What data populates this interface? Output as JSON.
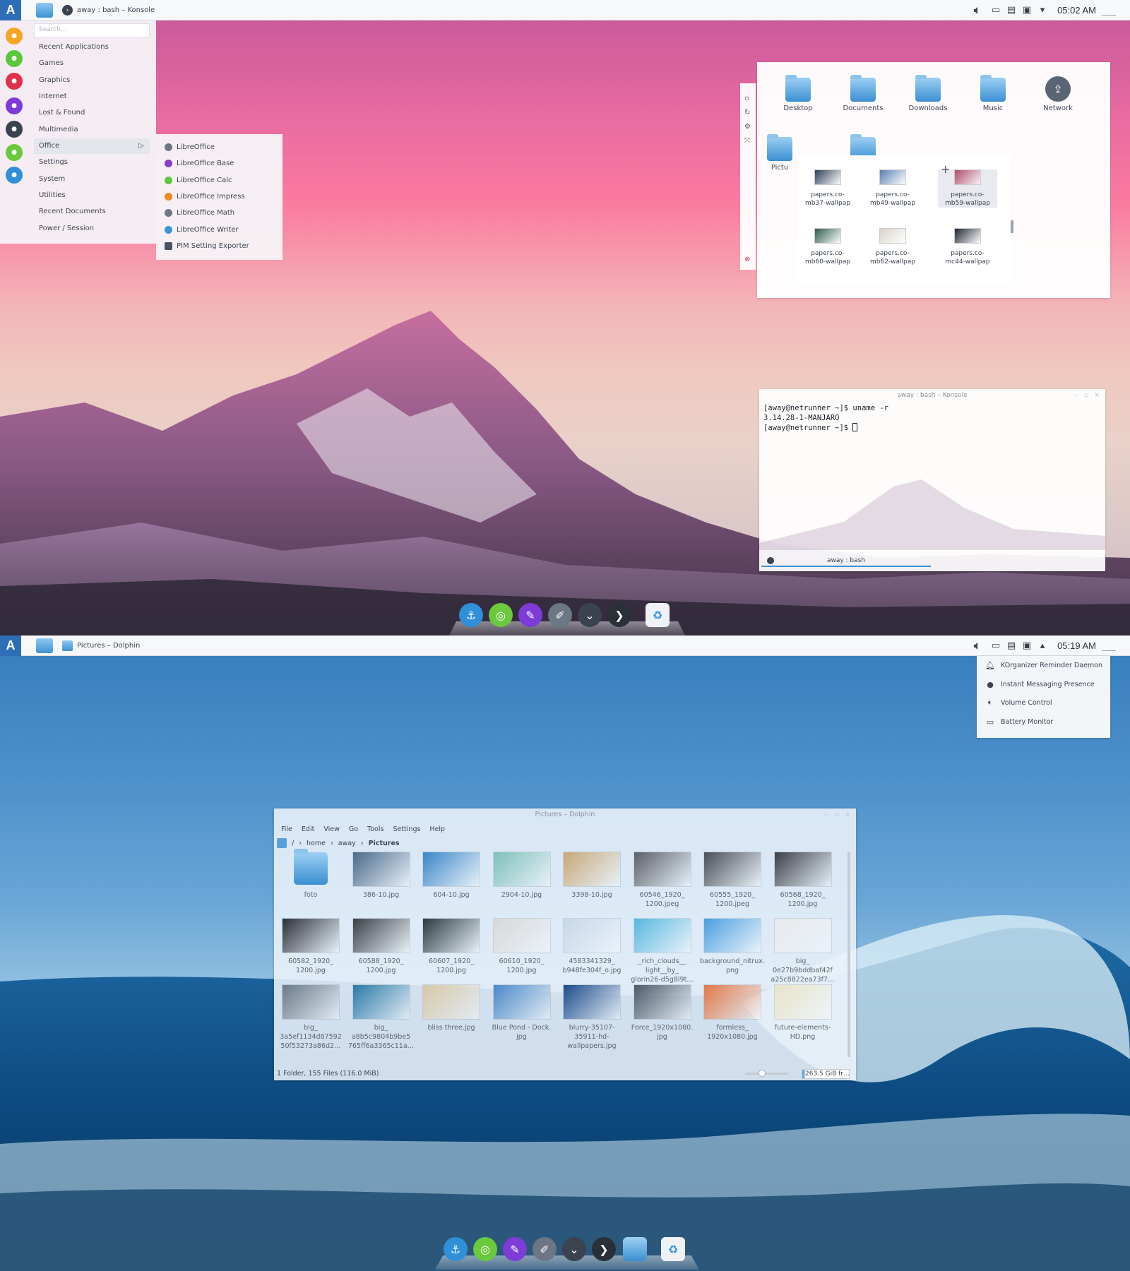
{
  "screen1": {
    "panel": {
      "task_title": "away : bash – Konsole",
      "clock": "05:02 AM"
    },
    "appmenu": {
      "search_placeholder": "Search...",
      "categories": [
        {
          "label": "Recent Applications"
        },
        {
          "label": "Games"
        },
        {
          "label": "Graphics"
        },
        {
          "label": "Internet"
        },
        {
          "label": "Lost & Found"
        },
        {
          "label": "Multimedia"
        },
        {
          "label": "Office"
        },
        {
          "label": "Settings"
        },
        {
          "label": "System"
        },
        {
          "label": "Utilities"
        },
        {
          "label": "Recent Documents"
        },
        {
          "label": "Power / Session"
        }
      ],
      "favorites": [
        {
          "icon": "media-player-icon",
          "color": "#f5a623"
        },
        {
          "icon": "refresh-icon",
          "color": "#5ac83a"
        },
        {
          "icon": "flash-icon",
          "color": "#e0304a"
        },
        {
          "icon": "messenger-icon",
          "color": "#7d3bd8"
        },
        {
          "icon": "settings-icon",
          "color": "#3b4350"
        },
        {
          "icon": "android-icon",
          "color": "#6ac93c"
        },
        {
          "icon": "system-icon",
          "color": "#2f8fd8"
        }
      ]
    },
    "submenu": {
      "items": [
        {
          "label": "LibreOffice",
          "color": "#6c7685"
        },
        {
          "label": "LibreOffice Base",
          "color": "#8a3bc8"
        },
        {
          "label": "LibreOffice Calc",
          "color": "#5ac83a"
        },
        {
          "label": "LibreOffice Impress",
          "color": "#f08a1c"
        },
        {
          "label": "LibreOffice Math",
          "color": "#6c7685"
        },
        {
          "label": "LibreOffice Writer",
          "color": "#3c92d4"
        },
        {
          "label": "PIM Setting Exporter",
          "color": "#4a5260"
        }
      ]
    },
    "folderview": {
      "icons": [
        {
          "label": "Desktop"
        },
        {
          "label": "Documents"
        },
        {
          "label": "Downloads"
        },
        {
          "label": "Music"
        },
        {
          "label": "Network"
        },
        {
          "label": "Pictu"
        }
      ],
      "preview": [
        {
          "line1": "papers.co-",
          "line2": "mb37-wallpap",
          "color": "#2c3e58"
        },
        {
          "line1": "papers.co-",
          "line2": "mb49-wallpap",
          "color": "#5a7fb0"
        },
        {
          "line1": "papers.co-",
          "line2": "mb59-wallpap",
          "color": "#b04a6a"
        },
        {
          "line1": "papers.co-",
          "line2": "mb60-wallpap",
          "color": "#2f5a4a"
        },
        {
          "line1": "papers.co-",
          "line2": "mb62-wallpap",
          "color": "#d8d2c8"
        },
        {
          "line1": "papers.co-",
          "line2": "mc44-wallpap",
          "color": "#1e2633"
        }
      ]
    },
    "konsole": {
      "title": "away : bash – Konsole",
      "line1": "[away@netrunner ~]$ uname -r",
      "line2": "3.14.28-1-MANJARO",
      "line3": "[away@netrunner ~]$ ",
      "tab": "away : bash"
    }
  },
  "screen2": {
    "panel": {
      "task_title": "Pictures – Dolphin",
      "clock": "05:19 AM"
    },
    "tray_popup": [
      {
        "label": "KOrganizer Reminder Daemon",
        "icon": "bell-icon"
      },
      {
        "label": "Instant Messaging Presence",
        "icon": "status-dot-icon"
      },
      {
        "label": "Volume Control",
        "icon": "speaker-icon"
      },
      {
        "label": "Battery Monitor",
        "icon": "battery-icon"
      }
    ],
    "dolphin": {
      "title": "Pictures – Dolphin",
      "menu": [
        "File",
        "Edit",
        "View",
        "Go",
        "Tools",
        "Settings",
        "Help"
      ],
      "breadcrumb": {
        "root": "/",
        "home": "home",
        "user": "away",
        "current": "Pictures"
      },
      "files": [
        {
          "name": "foto",
          "type": "folder"
        },
        {
          "name": "386-10.jpg",
          "color": "#4a6a8a"
        },
        {
          "name": "604-10.jpg",
          "color": "#3a86c8"
        },
        {
          "name": "2904-10.jpg",
          "color": "#7ec0b8"
        },
        {
          "name": "3398-10.jpg",
          "color": "#c8a878"
        },
        {
          "name": "60546_1920_\n1200.jpeg",
          "color": "#5a6068"
        },
        {
          "name": "60555_1920_\n1200.jpeg",
          "color": "#4a4e56"
        },
        {
          "name": "60568_1920_\n1200.jpg",
          "color": "#3a4048"
        },
        {
          "name": "60582_1920_\n1200.jpg",
          "color": "#2a3038"
        },
        {
          "name": "60588_1920_\n1200.jpg",
          "color": "#3a4046"
        },
        {
          "name": "60607_1920_\n1200.jpg",
          "color": "#2a3a40"
        },
        {
          "name": "60610_1920_\n1200.jpg",
          "color": "#d8d8d8"
        },
        {
          "name": "4583341329_\nb948fe304f_o.jpg",
          "color": "#c8d8e8"
        },
        {
          "name": "_rich_clouds__\nlight__by_\nglorin26-d5g8l9t…",
          "color": "#58b8e0"
        },
        {
          "name": "background_nitrux.\npng",
          "color": "#4aa0e0"
        },
        {
          "name": "big_\n0e27b9bddbaf42f\na25c8822ea73f7…",
          "color": "#e8eaec"
        },
        {
          "name": "big_\n3a5ef1134d87592\n50f53273a86d2…",
          "color": "#6a7a88"
        },
        {
          "name": "big_\na8b5c9804b9be5\n765ff6a3365c11a…",
          "color": "#2a7aa8"
        },
        {
          "name": "bliss three.jpg",
          "color": "#d8c8a8"
        },
        {
          "name": "Blue Pond - Dock.\njpg",
          "color": "#4a88c8"
        },
        {
          "name": "blurry-35107-\n35911-hd-\nwallpapers.jpg",
          "color": "#1a4a8a"
        },
        {
          "name": "Force_1920x1080.\njpg",
          "color": "#4a5a68"
        },
        {
          "name": "formless_\n1920x1080.jpg",
          "color": "#e07848"
        },
        {
          "name": "future-elements-\nHD.png",
          "color": "#e8e4c8"
        }
      ],
      "status": "1 Folder, 155 Files (116.0 MiB)",
      "free_space": "263.5 GiB fr…",
      "free_space_used_fraction": 0.05
    }
  },
  "dock_icons": [
    {
      "icon": "anchor-icon",
      "color": "#2f8fd8",
      "glyph": "⚓"
    },
    {
      "icon": "chrome-icon",
      "color": "#6ac93c",
      "glyph": "◎"
    },
    {
      "icon": "paint-brush-icon",
      "color": "#7d3bd8",
      "glyph": "✎"
    },
    {
      "icon": "edit-icon",
      "color": "#6c7685",
      "glyph": "✐"
    },
    {
      "icon": "chevron-down-icon",
      "color": "#3b4350",
      "glyph": "⌄"
    },
    {
      "icon": "terminal-icon",
      "color": "#2a3038",
      "glyph": "❯"
    },
    {
      "icon": "trash-recycle-icon",
      "color": "#eef2f7",
      "glyph": "♻"
    }
  ]
}
